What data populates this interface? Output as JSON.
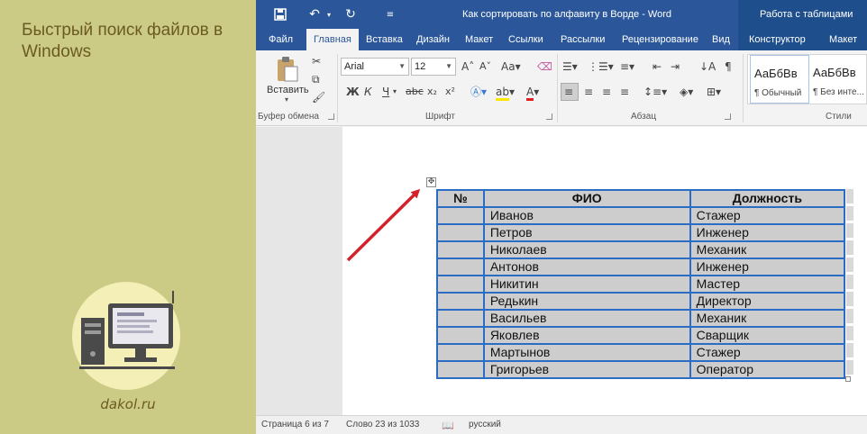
{
  "promo": {
    "title": "Быстрый поиск файлов в Windows",
    "site": "dakol.ru"
  },
  "titlebar": {
    "document_title": "Как сортировать по алфавиту в Ворде - Word",
    "contextual_header": "Работа с таблицами"
  },
  "tabs": [
    {
      "label": "Файл"
    },
    {
      "label": "Главная"
    },
    {
      "label": "Вставка"
    },
    {
      "label": "Дизайн"
    },
    {
      "label": "Макет"
    },
    {
      "label": "Ссылки"
    },
    {
      "label": "Рассылки"
    },
    {
      "label": "Рецензирование"
    },
    {
      "label": "Вид"
    },
    {
      "label": "Конструктор"
    },
    {
      "label": "Макет"
    }
  ],
  "ribbon": {
    "paste_label": "Вставить",
    "font_name": "Arial",
    "font_size": "12",
    "groups": {
      "clipboard": "Буфер обмена",
      "font": "Шрифт",
      "paragraph": "Абзац",
      "styles": "Стили"
    },
    "styles": [
      {
        "sample": "АаБбВв",
        "name": "¶ Обычный"
      },
      {
        "sample": "АаБбВв",
        "name": "¶ Без инте..."
      }
    ]
  },
  "table": {
    "headers": [
      "№",
      "ФИО",
      "Должность"
    ],
    "rows": [
      [
        "",
        "Иванов",
        "Стажер"
      ],
      [
        "",
        "Петров",
        "Инженер"
      ],
      [
        "",
        "Николаев",
        "Механик"
      ],
      [
        "",
        "Антонов",
        "Инженер"
      ],
      [
        "",
        "Никитин",
        "Мастер"
      ],
      [
        "",
        "Редькин",
        "Директор"
      ],
      [
        "",
        "Васильев",
        "Механик"
      ],
      [
        "",
        "Яковлев",
        "Сварщик"
      ],
      [
        "",
        "Мартынов",
        "Стажер"
      ],
      [
        "",
        "Григорьев",
        "Оператор"
      ]
    ]
  },
  "statusbar": {
    "page": "Страница 6 из 7",
    "words": "Слово 23 из 1033",
    "language": "русский"
  },
  "colors": {
    "word_blue": "#2b579a",
    "promo_bg": "#cccb85",
    "arrow": "#d3222a",
    "table_border": "#2b6cc4"
  }
}
